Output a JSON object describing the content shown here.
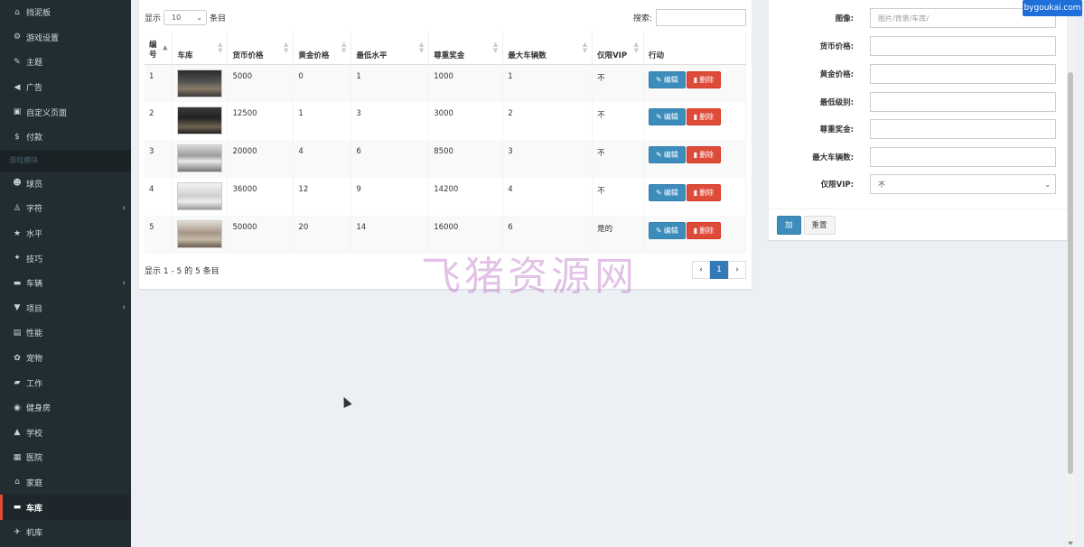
{
  "sidebar": {
    "items_top": [
      {
        "label": "挡泥板",
        "icon": "home-icon"
      },
      {
        "label": "游戏设置",
        "icon": "gears-icon"
      },
      {
        "label": "主题",
        "icon": "paint-brush-icon"
      },
      {
        "label": "广告",
        "icon": "bullhorn-icon"
      },
      {
        "label": "自定义页面",
        "icon": "page-icon"
      },
      {
        "label": "付款",
        "icon": "dollar-icon"
      }
    ],
    "section_header": "游戏模块",
    "items_bottom": [
      {
        "label": "球员",
        "icon": "users-icon",
        "chevron": false
      },
      {
        "label": "字符",
        "icon": "child-icon",
        "chevron": true
      },
      {
        "label": "水平",
        "icon": "star-icon",
        "chevron": false
      },
      {
        "label": "技巧",
        "icon": "bolt-icon",
        "chevron": false
      },
      {
        "label": "车辆",
        "icon": "car-icon",
        "chevron": true
      },
      {
        "label": "项目",
        "icon": "cart-icon",
        "chevron": true
      },
      {
        "label": "性能",
        "icon": "file-icon",
        "chevron": false
      },
      {
        "label": "宠物",
        "icon": "paw-icon",
        "chevron": false
      },
      {
        "label": "工作",
        "icon": "briefcase-icon",
        "chevron": false
      },
      {
        "label": "健身房",
        "icon": "futbol-icon",
        "chevron": false
      },
      {
        "label": "学校",
        "icon": "graduation-cap-icon",
        "chevron": false
      },
      {
        "label": "医院",
        "icon": "hospital-icon",
        "chevron": false
      },
      {
        "label": "家庭",
        "icon": "house-icon",
        "chevron": false
      },
      {
        "label": "车库",
        "icon": "car-front-icon",
        "chevron": false,
        "active": true
      },
      {
        "label": "机库",
        "icon": "plane-icon",
        "chevron": false
      }
    ]
  },
  "table_controls": {
    "show_prefix": "显示",
    "page_size": "10",
    "show_suffix": "条目",
    "search_label": "搜索:"
  },
  "columns": [
    "编号",
    "车库",
    "货币价格",
    "黄金价格",
    "最低水平",
    "尊重奖金",
    "最大车辆数",
    "仅限VIP",
    "行动"
  ],
  "rows": [
    {
      "id": "1",
      "coin": "5000",
      "gold": "0",
      "min_level": "1",
      "respect": "1000",
      "max_vehicles": "1",
      "vip": "不"
    },
    {
      "id": "2",
      "coin": "12500",
      "gold": "1",
      "min_level": "3",
      "respect": "3000",
      "max_vehicles": "2",
      "vip": "不"
    },
    {
      "id": "3",
      "coin": "20000",
      "gold": "4",
      "min_level": "6",
      "respect": "8500",
      "max_vehicles": "3",
      "vip": "不"
    },
    {
      "id": "4",
      "coin": "36000",
      "gold": "12",
      "min_level": "9",
      "respect": "14200",
      "max_vehicles": "4",
      "vip": "不"
    },
    {
      "id": "5",
      "coin": "50000",
      "gold": "20",
      "min_level": "14",
      "respect": "16000",
      "max_vehicles": "6",
      "vip": "是的"
    }
  ],
  "actions": {
    "edit": "编辑",
    "delete": "删除"
  },
  "footer": {
    "info": "显示 1 - 5 的 5 条目",
    "page": "1"
  },
  "form": {
    "image_label": "图像:",
    "image_placeholder": "图片/背景/车库/",
    "coin_label": "货币价格:",
    "gold_label": "黄金价格:",
    "min_level_label": "最低级别:",
    "respect_label": "尊重奖金:",
    "max_vehicles_label": "最大车辆数:",
    "vip_label": "仅限VIP:",
    "vip_value": "不",
    "add_button": "加",
    "reset_button": "重置"
  },
  "watermark": "飞猪资源网",
  "badge": "bygoukai.com",
  "colors": {
    "primary": "#3c8dbc",
    "danger": "#dd4b39",
    "sidebar": "#222d32"
  }
}
